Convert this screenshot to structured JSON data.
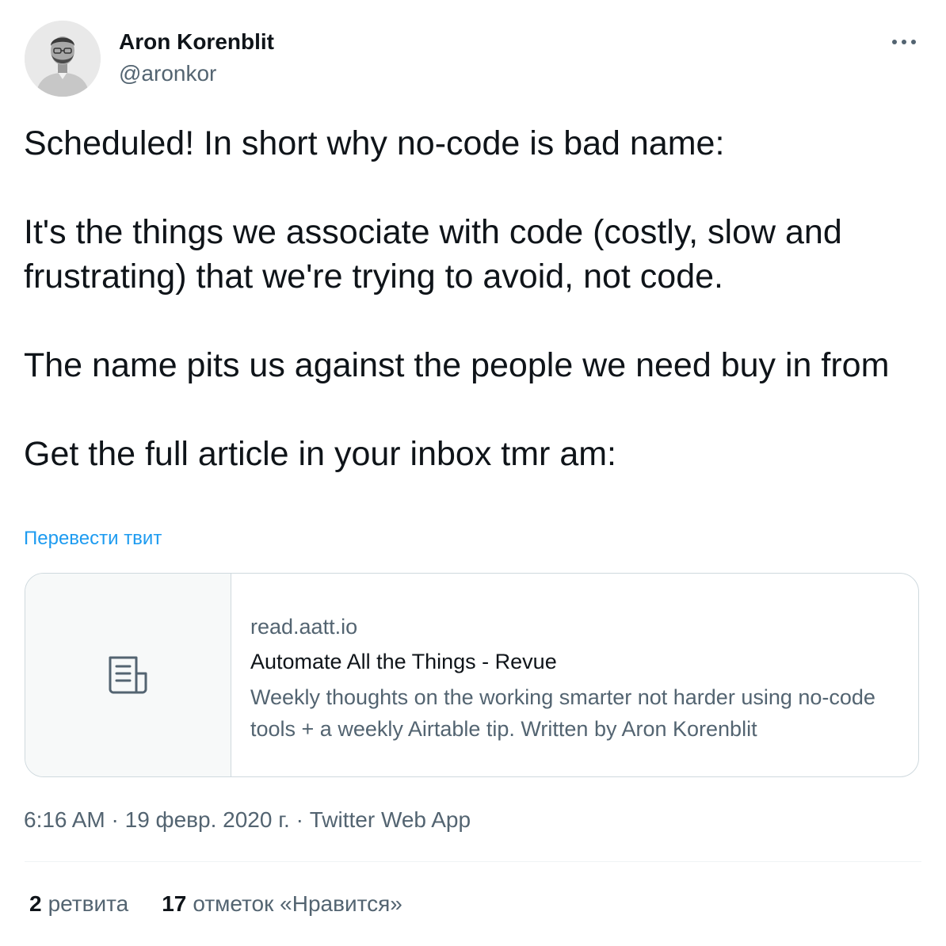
{
  "author": {
    "name": "Aron Korenblit",
    "handle": "@aronkor",
    "avatar_icon": "profile-photo"
  },
  "more_icon": "more-horizontal-icon",
  "tweet": {
    "text": "Scheduled! In short why no-code is bad name:\n\nIt's the things we associate with code (costly, slow and frustrating) that we're trying to avoid, not code.\n\nThe name pits us against the people we need buy in from\n\nGet the full article in your inbox tmr am:",
    "translate_label": "Перевести твит"
  },
  "card": {
    "media_icon": "article-icon",
    "domain": "read.aatt.io",
    "title": "Automate All the Things - Revue",
    "description": "Weekly thoughts on the working smarter not harder using no-code tools + a weekly Airtable tip. Written by Aron Korenblit"
  },
  "meta": {
    "time": "6:16 AM",
    "separator": " · ",
    "date": "19 февр. 2020 г.",
    "source": "Twitter Web App"
  },
  "stats": {
    "retweets": {
      "count": "2",
      "label": "ретвита"
    },
    "likes": {
      "count": "17",
      "label": "отметок «Нравится»"
    }
  },
  "colors": {
    "text_primary": "#0f1419",
    "text_secondary": "#536471",
    "link": "#1d9bf0",
    "border": "#cfd9de"
  }
}
